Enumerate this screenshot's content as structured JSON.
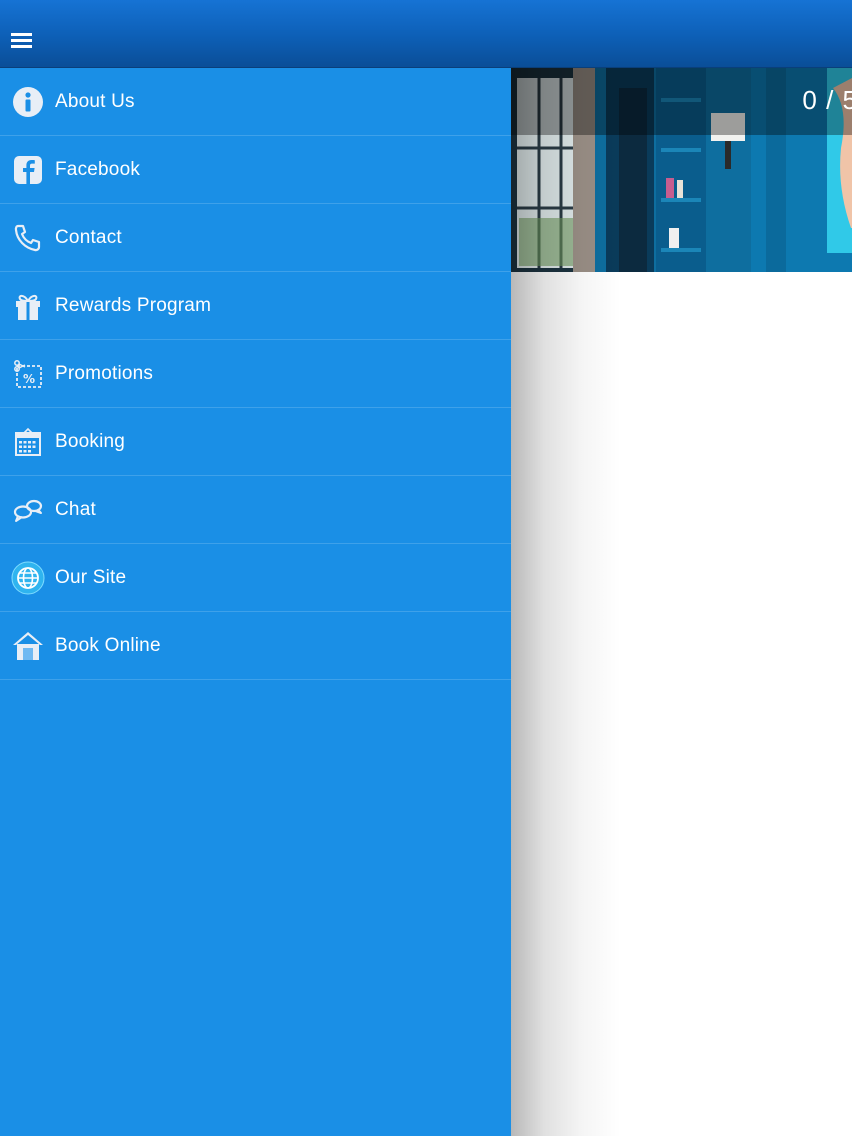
{
  "slider": {
    "counter": "0 / 5"
  },
  "menu": {
    "items": [
      {
        "label": "About Us",
        "icon": "info-icon"
      },
      {
        "label": "Facebook",
        "icon": "facebook-icon"
      },
      {
        "label": "Contact",
        "icon": "phone-icon"
      },
      {
        "label": "Rewards Program",
        "icon": "gift-icon"
      },
      {
        "label": "Promotions",
        "icon": "coupon-icon"
      },
      {
        "label": "Booking",
        "icon": "calendar-icon"
      },
      {
        "label": "Chat",
        "icon": "chat-icon"
      },
      {
        "label": "Our Site",
        "icon": "globe-icon"
      },
      {
        "label": "Book Online",
        "icon": "home-icon"
      }
    ]
  },
  "colors": {
    "drawer_background": "#1a8fe6",
    "header_gradient_top": "#1673d4",
    "header_gradient_bottom": "#0a4e98",
    "icon_color": "#e8eef6"
  }
}
